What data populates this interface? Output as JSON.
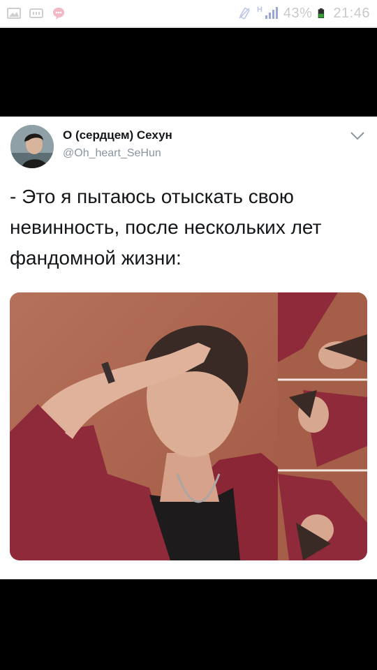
{
  "status_bar": {
    "battery_percent": "43%",
    "time": "21:46",
    "network_label": "H",
    "icons": [
      "image-icon",
      "keyboard-icon",
      "chat-bubble-icon",
      "vibrate-icon",
      "signal-icon",
      "battery-icon"
    ]
  },
  "tweet": {
    "display_name": "О (сердцем) Сехун",
    "handle": "@Oh_heart_SeHun",
    "text": "- Это я пытаюсь отыскать свою невинность, после нескольких лет фандомной жизни:",
    "menu_icon": "chevron-down-icon"
  },
  "colors": {
    "tweet_background": "#ffffff",
    "name_color": "#14171a",
    "handle_color": "#8a949e",
    "status_icon_color": "#c9c9c9",
    "photo_background": "#b06f55",
    "jacket": "#8e2a3a"
  }
}
